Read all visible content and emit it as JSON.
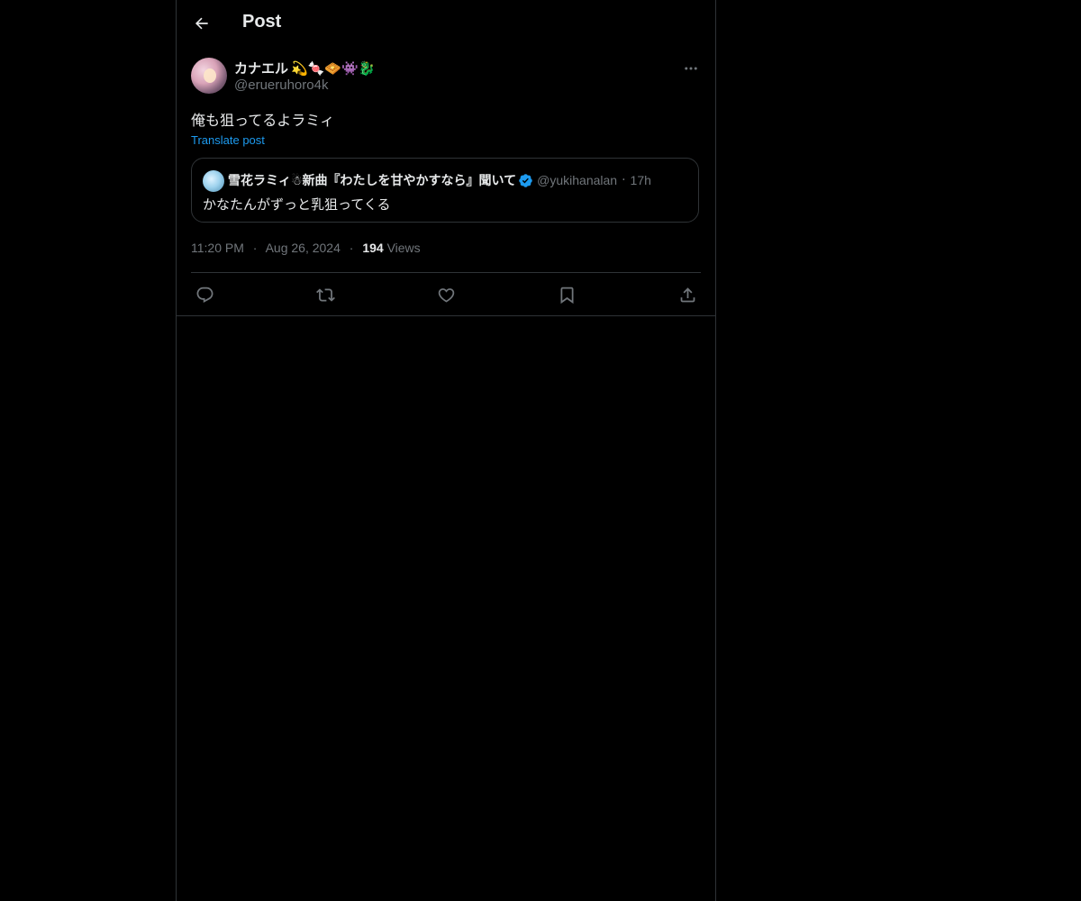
{
  "header": {
    "title": "Post"
  },
  "tweet": {
    "author_name": "カナエル",
    "author_emojis": "💫🍬🧇👾🐉",
    "author_handle": "@erueruhoro4k",
    "text": "俺も狙ってるよラミィ",
    "translate_label": "Translate post",
    "quote": {
      "name": "雪花ラミィ☃新曲『わたしを甘やかすなら』聞いて",
      "handle": "@yukihanalan",
      "dot": "·",
      "time": "17h",
      "text": "かなたんがずっと乳狙ってくる"
    },
    "time": "11:20 PM",
    "date": "Aug 26, 2024",
    "views_count": "194",
    "views_label": "Views",
    "separator": "·"
  },
  "icons": {
    "back": "arrow-left-icon",
    "more": "more-horizontal-icon",
    "verified": "verified-badge-icon",
    "reply": "reply-icon",
    "repost": "repost-icon",
    "like": "heart-icon",
    "bookmark": "bookmark-icon",
    "share": "share-icon"
  },
  "colors": {
    "background": "#000000",
    "text": "#e7e9ea",
    "secondary": "#71767b",
    "accent": "#1d9bf0",
    "border": "#2f3336"
  }
}
